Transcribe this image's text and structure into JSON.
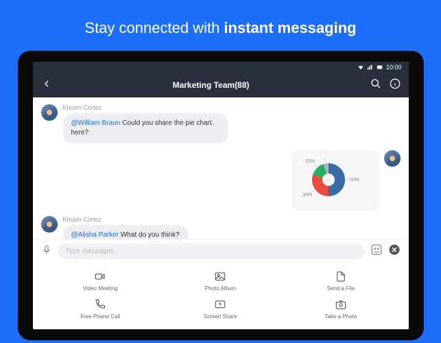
{
  "promo": {
    "text_plain": "Stay connected with ",
    "text_bold": "instant messaging"
  },
  "statusbar": {
    "time": "10:00"
  },
  "header": {
    "title": "Marketing Team(88)"
  },
  "messages": [
    {
      "sender": "Khushi Cortez",
      "mention": "@William Braun",
      "text": " Could you share the pie chart here?"
    },
    {
      "sender": "Khushi Cortez",
      "mention": "@Alisha Parker",
      "text": " What do you think?"
    }
  ],
  "input": {
    "placeholder": "Type messages..."
  },
  "actions": [
    {
      "label": "Video Meeting",
      "icon": "video-icon"
    },
    {
      "label": "Photo Album",
      "icon": "photo-icon"
    },
    {
      "label": "Send a File",
      "icon": "file-icon"
    },
    {
      "label": "Free Phone Call",
      "icon": "phone-icon"
    },
    {
      "label": "Screen Share",
      "icon": "screenshare-icon"
    },
    {
      "label": "Take a Photo",
      "icon": "camera-icon"
    }
  ],
  "chart_data": {
    "type": "pie",
    "title": "",
    "slices": [
      {
        "label": "50%",
        "value": 50,
        "color": "#3a6aa5"
      },
      {
        "label": "30%",
        "value": 30,
        "color": "#e84c3d"
      },
      {
        "label": "15%",
        "value": 15,
        "color": "#27ae60"
      },
      {
        "label": "5%",
        "value": 5,
        "color": "#a8b5c4"
      }
    ]
  }
}
